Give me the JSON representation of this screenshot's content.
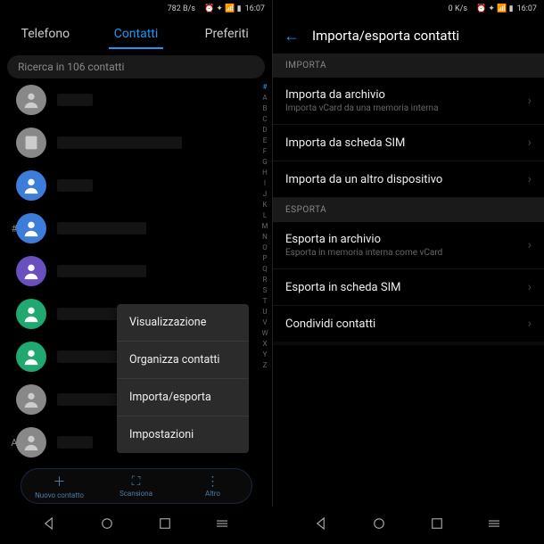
{
  "status": {
    "speed_left": "782 B/s",
    "speed_right": "0 K/s",
    "time": "16:07"
  },
  "tabs": {
    "phone": "Telefono",
    "contacts": "Contatti",
    "favorites": "Preferiti"
  },
  "search": {
    "placeholder": "Ricerca in 106 contatti"
  },
  "section_marks": {
    "hash": "#",
    "a": "A"
  },
  "alpha": [
    "#",
    "A",
    "B",
    "C",
    "D",
    "E",
    "F",
    "G",
    "H",
    "I",
    "J",
    "K",
    "L",
    "M",
    "N",
    "O",
    "P",
    "Q",
    "R",
    "S",
    "T",
    "U",
    "V",
    "W",
    "X",
    "Y",
    "Z"
  ],
  "popup": {
    "view": "Visualizzazione",
    "organize": "Organizza contatti",
    "import": "Importa/esporta",
    "settings": "Impostazioni"
  },
  "bottombar": {
    "new": "Nuovo contatto",
    "scan": "Scansiona",
    "more": "Altro"
  },
  "right_header": "Importa/esporta contatti",
  "sections": {
    "import": "IMPORTA",
    "export": "ESPORTA"
  },
  "import_items": {
    "archive": {
      "title": "Importa da archivio",
      "sub": "Importa vCard da una memoria interna"
    },
    "sim": {
      "title": "Importa da scheda SIM"
    },
    "device": {
      "title": "Importa da un altro dispositivo"
    }
  },
  "export_items": {
    "archive": {
      "title": "Esporta in archivio",
      "sub": "Esporta in memoria interna come vCard"
    },
    "sim": {
      "title": "Esporta in scheda SIM"
    },
    "share": {
      "title": "Condividi contatti"
    }
  },
  "avatar_colors": [
    "#888",
    "#888",
    "#3b7dd8",
    "#3b7dd8",
    "#6a4fbf",
    "#1fa870",
    "#1fa870",
    "#888",
    "#888",
    "#3b7dd8"
  ]
}
